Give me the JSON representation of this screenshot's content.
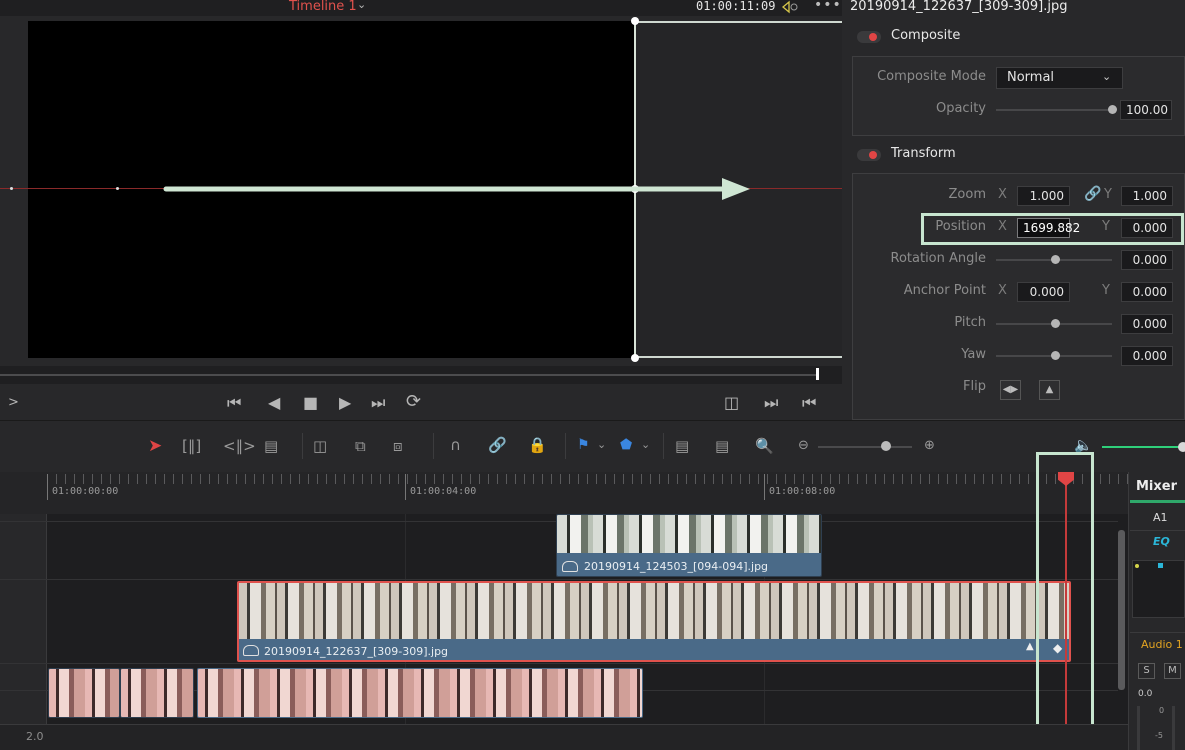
{
  "viewer": {
    "timeline_name": "Timeline 1",
    "timecode": "01:00:11:09",
    "more": "•••"
  },
  "inspector": {
    "clip_title": "20190914_122637_[309-309].jpg",
    "composite": {
      "title": "Composite",
      "mode_label": "Composite Mode",
      "mode_value": "Normal",
      "opacity_label": "Opacity",
      "opacity_value": "100.00",
      "opacity_level": 1.0
    },
    "transform": {
      "title": "Transform",
      "zoom_label": "Zoom",
      "zoom_x": "1.000",
      "zoom_y": "1.000",
      "position_label": "Position",
      "position_x": "1699.882",
      "position_y": "0.000",
      "rotation_label": "Rotation Angle",
      "rotation_value": "0.000",
      "anchor_label": "Anchor Point",
      "anchor_x": "0.000",
      "anchor_y": "0.000",
      "pitch_label": "Pitch",
      "pitch_value": "0.000",
      "yaw_label": "Yaw",
      "yaw_value": "0.000",
      "flip_label": "Flip",
      "axis_x": "X",
      "axis_y": "Y"
    }
  },
  "timeline": {
    "ruler": [
      "01:00:00:00",
      "01:00:04:00",
      "01:00:08:00"
    ],
    "clips": {
      "top": "20190914_124503_[094-094].jpg",
      "selected": "20190914_122637_[309-309].jpg"
    },
    "bottom_value": "2.0"
  },
  "mixer": {
    "title": "Mixer",
    "channel": "A1",
    "eq": "EQ",
    "track_name": "Audio 1",
    "solo": "S",
    "mute": "M",
    "level": "0.0",
    "meter_0": "0",
    "meter_5": "-5"
  },
  "colors": {
    "accent_red": "#e04545",
    "highlight_green": "#c7e5cf",
    "clip_blue": "#4a6a88",
    "volume_green": "#2fd07a"
  }
}
